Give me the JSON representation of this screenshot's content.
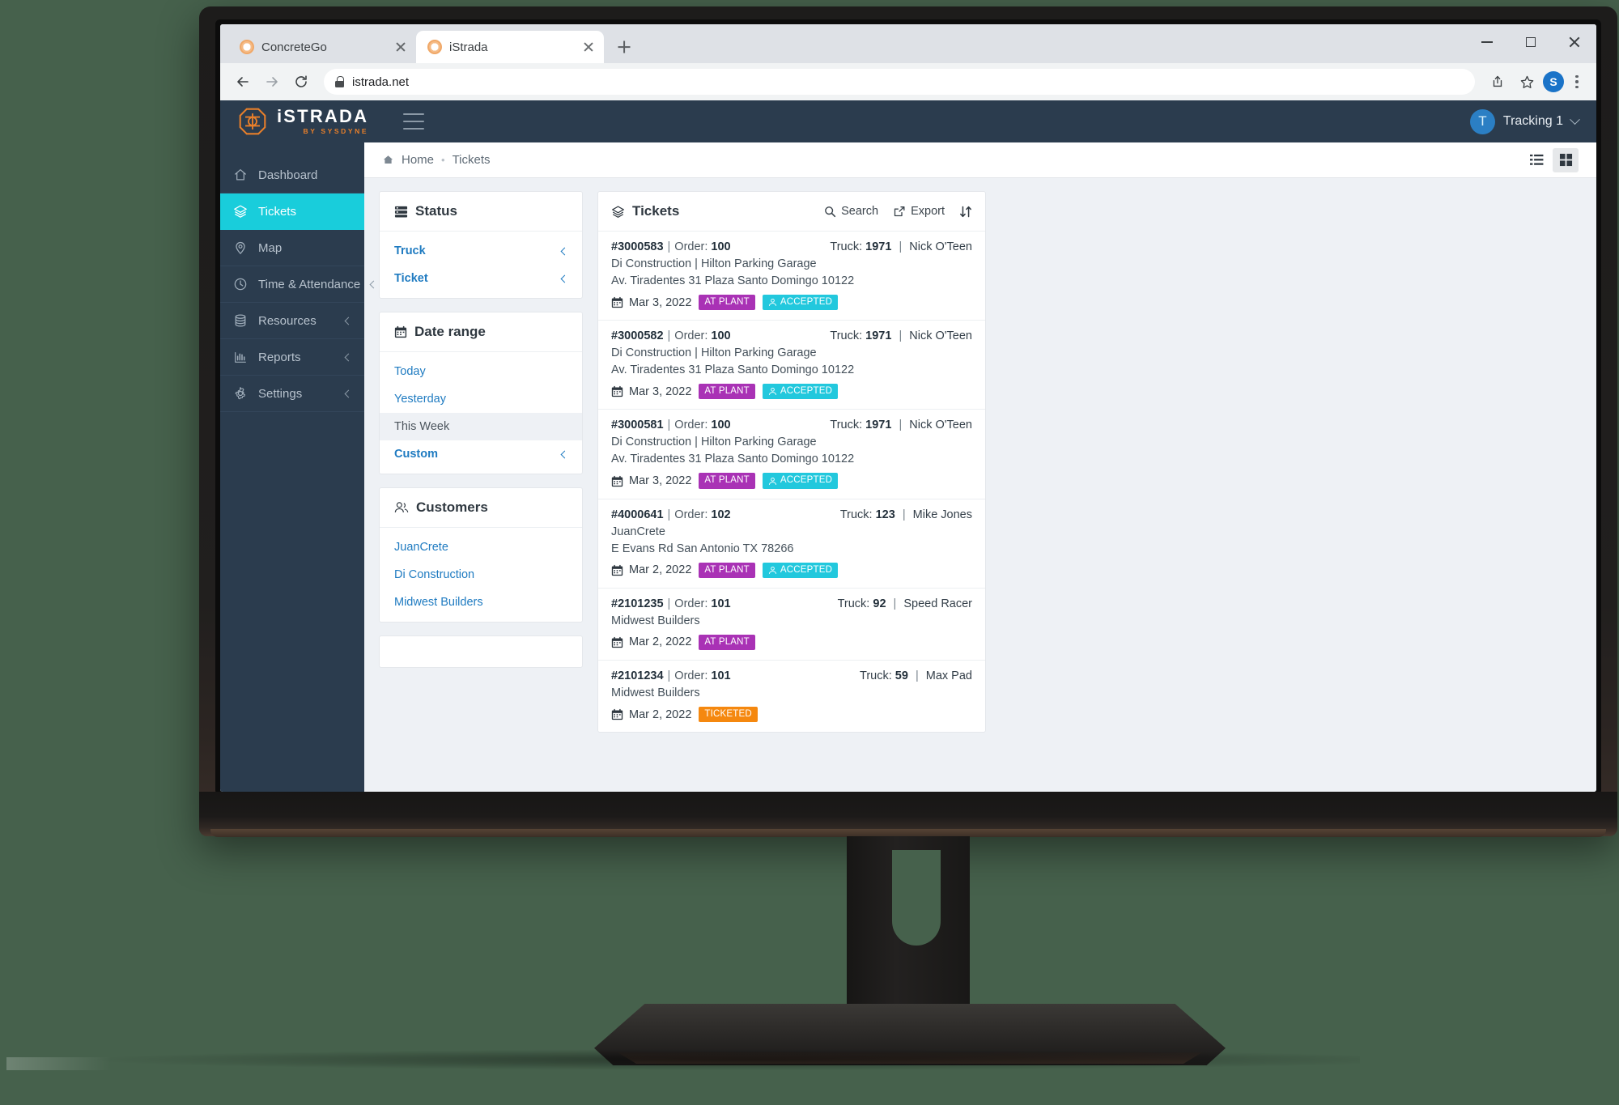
{
  "browser": {
    "tabs": [
      {
        "title": "ConcreteGo",
        "active": false,
        "favicon": "concretego-favicon"
      },
      {
        "title": "iStrada",
        "active": true,
        "favicon": "istrada-favicon"
      }
    ],
    "new_tab_label": "+",
    "window_controls": [
      "minimize",
      "maximize",
      "close"
    ],
    "url": "istrada.net",
    "profile_initial": "S",
    "toolbar_icons": [
      "back-arrow",
      "forward-arrow",
      "reload",
      "lock",
      "share",
      "bookmark-star",
      "profile",
      "menu"
    ]
  },
  "appbar": {
    "brand_name": "iSTRADA",
    "brand_sub": "BY SYSDYNE",
    "menu_icon": "hamburger-icon",
    "user_initial": "T",
    "user_name": "Tracking 1"
  },
  "sidebar": {
    "items": [
      {
        "label": "Dashboard",
        "icon": "home-icon",
        "active": false,
        "expandable": false
      },
      {
        "label": "Tickets",
        "icon": "layers-icon",
        "active": true,
        "expandable": false
      },
      {
        "label": "Map",
        "icon": "map-pin-icon",
        "active": false,
        "expandable": false
      },
      {
        "label": "Time & Attendance",
        "icon": "clock-icon",
        "active": false,
        "expandable": true
      },
      {
        "label": "Resources",
        "icon": "database-icon",
        "active": false,
        "expandable": true
      },
      {
        "label": "Reports",
        "icon": "bar-chart-icon",
        "active": false,
        "expandable": true
      },
      {
        "label": "Settings",
        "icon": "gear-icon",
        "active": false,
        "expandable": true
      }
    ]
  },
  "breadcrumb": {
    "home_icon": "home-icon",
    "home": "Home",
    "separator": "•",
    "current": "Tickets"
  },
  "view_toggle": {
    "list_icon": "list-view-icon",
    "grid_icon": "grid-view-icon",
    "active": "grid"
  },
  "status_panel": {
    "title": "Status",
    "icon": "server-icon",
    "items": [
      {
        "label": "Truck",
        "expandable": true
      },
      {
        "label": "Ticket",
        "expandable": true
      }
    ]
  },
  "date_range_panel": {
    "title": "Date range",
    "icon": "calendar-icon",
    "items": [
      {
        "label": "Today",
        "selected": false,
        "expandable": false
      },
      {
        "label": "Yesterday",
        "selected": false,
        "expandable": false
      },
      {
        "label": "This Week",
        "selected": true,
        "expandable": false
      },
      {
        "label": "Custom",
        "selected": false,
        "expandable": true
      }
    ]
  },
  "customers_panel": {
    "title": "Customers",
    "icon": "users-icon",
    "items": [
      {
        "label": "JuanCrete"
      },
      {
        "label": "Di Construction"
      },
      {
        "label": "Midwest Builders"
      }
    ]
  },
  "tickets_panel": {
    "title": "Tickets",
    "icon": "layers-icon",
    "actions": [
      {
        "label": "Search",
        "icon": "search-icon"
      },
      {
        "label": "Export",
        "icon": "export-icon"
      }
    ],
    "sort_icon": "sort-icon",
    "order_label": "Order:",
    "truck_label": "Truck:",
    "separator": "|",
    "rows": [
      {
        "id": "#3000583",
        "order": "100",
        "truck": "1971",
        "driver": "Nick O'Teen",
        "customer": "Di Construction | Hilton Parking Garage",
        "address": "Av. Tiradentes 31 Plaza Santo Domingo 10122",
        "date": "Mar 3, 2022",
        "badges": [
          {
            "label": "AT PLANT",
            "color": "#a932b5",
            "icon": null
          },
          {
            "label": "ACCEPTED",
            "color": "#22c8dd",
            "icon": "person-icon"
          }
        ]
      },
      {
        "id": "#3000582",
        "order": "100",
        "truck": "1971",
        "driver": "Nick O'Teen",
        "customer": "Di Construction | Hilton Parking Garage",
        "address": "Av. Tiradentes 31 Plaza Santo Domingo 10122",
        "date": "Mar 3, 2022",
        "badges": [
          {
            "label": "AT PLANT",
            "color": "#a932b5",
            "icon": null
          },
          {
            "label": "ACCEPTED",
            "color": "#22c8dd",
            "icon": "person-icon"
          }
        ]
      },
      {
        "id": "#3000581",
        "order": "100",
        "truck": "1971",
        "driver": "Nick O'Teen",
        "customer": "Di Construction | Hilton Parking Garage",
        "address": "Av. Tiradentes 31 Plaza Santo Domingo 10122",
        "date": "Mar 3, 2022",
        "badges": [
          {
            "label": "AT PLANT",
            "color": "#a932b5",
            "icon": null
          },
          {
            "label": "ACCEPTED",
            "color": "#22c8dd",
            "icon": "person-icon"
          }
        ]
      },
      {
        "id": "#4000641",
        "order": "102",
        "truck": "123",
        "driver": "Mike Jones",
        "customer": "JuanCrete",
        "address": "E Evans Rd San Antonio TX 78266",
        "date": "Mar 2, 2022",
        "badges": [
          {
            "label": "AT PLANT",
            "color": "#a932b5",
            "icon": null
          },
          {
            "label": "ACCEPTED",
            "color": "#22c8dd",
            "icon": "person-icon"
          }
        ]
      },
      {
        "id": "#2101235",
        "order": "101",
        "truck": "92",
        "driver": "Speed Racer",
        "customer": "Midwest Builders",
        "address": "",
        "date": "Mar 2, 2022",
        "badges": [
          {
            "label": "AT PLANT",
            "color": "#a932b5",
            "icon": null
          }
        ]
      },
      {
        "id": "#2101234",
        "order": "101",
        "truck": "59",
        "driver": "Max Pad",
        "customer": "Midwest Builders",
        "address": "",
        "date": "Mar 2, 2022",
        "badges": [
          {
            "label": "TICKETED",
            "color": "#f5880f",
            "icon": null
          }
        ]
      }
    ]
  },
  "colors": {
    "accent_cyan": "#19cddb",
    "sidebar_navy": "#2b3c4e",
    "brand_orange": "#e87f2a",
    "link_blue": "#1f7bc1",
    "badge_at_plant": "#a932b5",
    "badge_accepted": "#22c8dd",
    "badge_ticketed": "#f5880f",
    "page_bg": "#46614c"
  }
}
